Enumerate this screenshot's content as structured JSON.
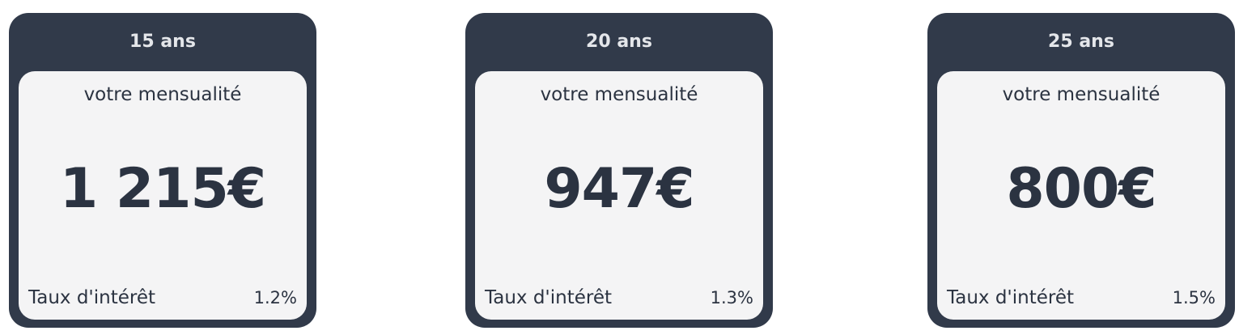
{
  "cards": [
    {
      "duration": "15 ans",
      "payment_label": "votre mensualité",
      "amount": "1 215€",
      "rate_label": "Taux d'intérêt",
      "rate_value": "1.2%"
    },
    {
      "duration": "20 ans",
      "payment_label": "votre mensualité",
      "amount": "947€",
      "rate_label": "Taux d'intérêt",
      "rate_value": "1.3%"
    },
    {
      "duration": "25 ans",
      "payment_label": "votre mensualité",
      "amount": "800€",
      "rate_label": "Taux d'intérêt",
      "rate_value": "1.5%"
    }
  ],
  "colors": {
    "card_bg": "#313a4a",
    "panel_bg": "#f4f4f5",
    "text_dark": "#2b3341",
    "header_text": "#e4e6ea"
  }
}
